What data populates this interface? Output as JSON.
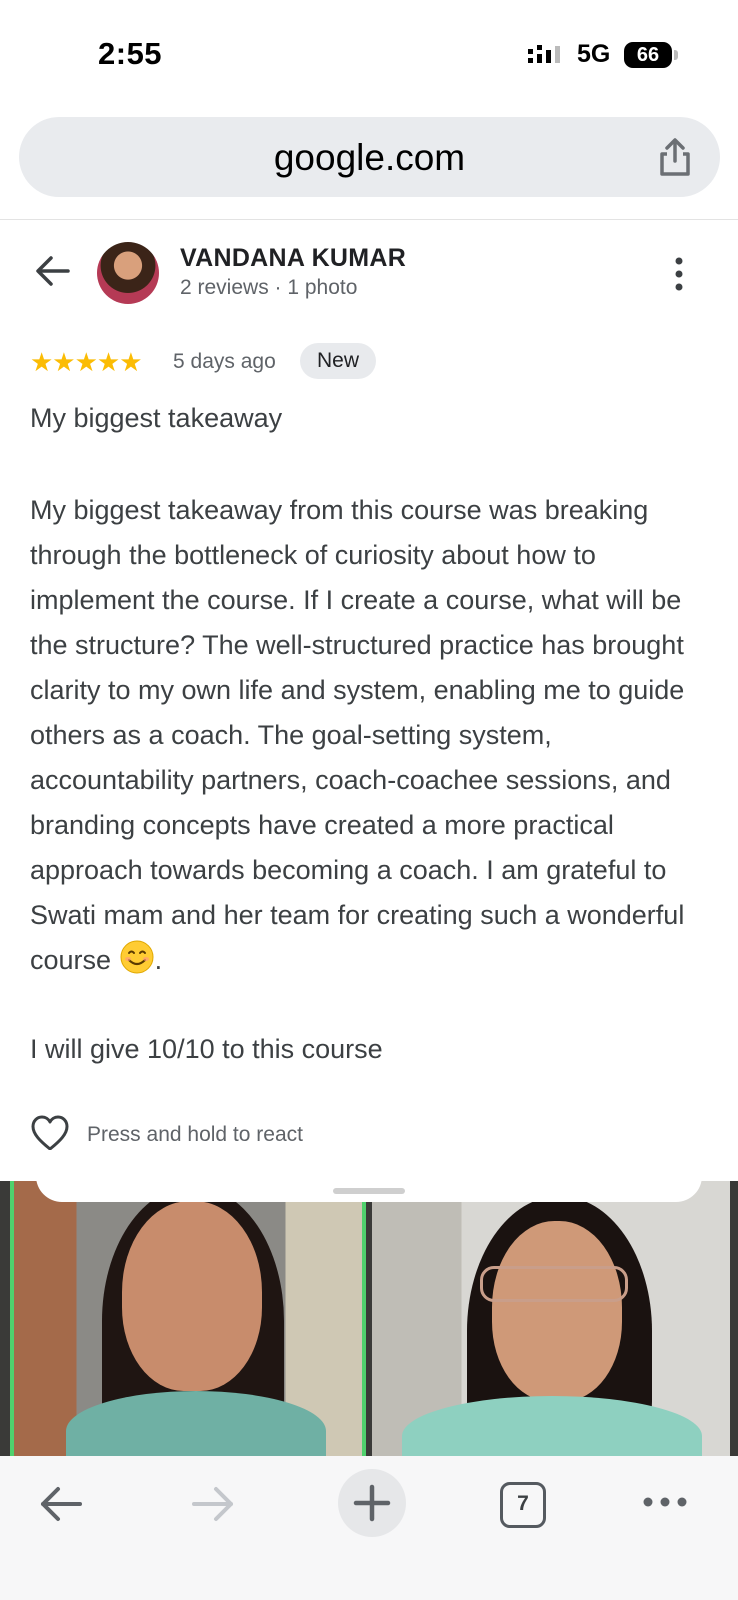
{
  "status_bar": {
    "time": "2:55",
    "network": "5G",
    "battery": "66"
  },
  "browser": {
    "url": "google.com",
    "open_tabs": "7"
  },
  "review": {
    "reviewer_name": "VANDANA KUMAR",
    "reviewer_meta": "2 reviews · 1 photo",
    "stars": "★★★★★",
    "rating": 5,
    "time_ago": "5 days ago",
    "badge": "New",
    "title": "My biggest takeaway",
    "body": "My biggest takeaway from this course was breaking through the bottleneck of curiosity about how to implement the course. If I create a course, what will be the structure? The well-structured practice has brought clarity to my own life and system, enabling me to guide others as a coach. The goal-setting system, accountability partners, coach-coachee sessions, and branding concepts have created a more practical approach towards becoming a coach. I am grateful to Swati mam and her team for creating such a wonderful course",
    "body_end": ".",
    "footer_line": "I will give 10/10 to this course",
    "react_hint": "Press and hold to react"
  },
  "colors": {
    "star": "#fbbc04",
    "speaker_highlight": "#4fd16d",
    "url_bar": "#e9ebee"
  },
  "icons": [
    "back-arrow-icon",
    "more-vert-icon",
    "share-icon",
    "heart-icon",
    "smiley-emoji-icon",
    "forward-arrow-icon",
    "plus-icon",
    "tabs-icon",
    "more-horiz-icon"
  ]
}
